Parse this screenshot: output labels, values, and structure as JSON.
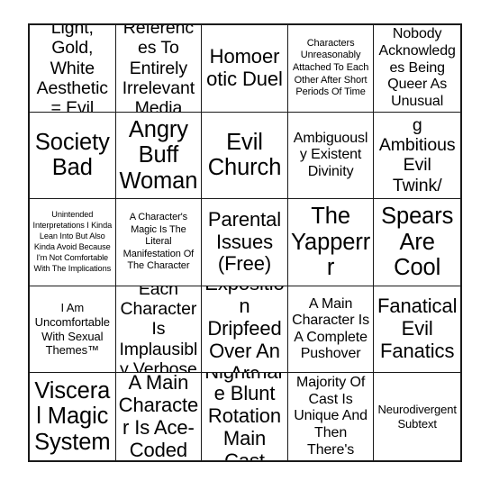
{
  "card": {
    "type": "bingo-card",
    "columns": 5,
    "rows": 5,
    "background_color": "#ffffff",
    "border_color": "#1a1a1a",
    "text_color": "#000000",
    "cells": [
      {
        "text": "Light, Gold, White Aesthetic = Evil",
        "size": "lg"
      },
      {
        "text": "References To Entirely Irrelevant Media",
        "size": "lg"
      },
      {
        "text": "Homoerotic Duel",
        "size": "xl"
      },
      {
        "text": "Characters Unreasonably Attached To Each Other After Short Periods Of Time",
        "size": "xs"
      },
      {
        "text": "Nobody Acknowledges Being Queer As Unusual",
        "size": "md"
      },
      {
        "text": "Society Bad",
        "size": "xxl"
      },
      {
        "text": "Angry Buff Woman",
        "size": "xxl"
      },
      {
        "text": "Evil Church",
        "size": "xxl"
      },
      {
        "text": "Ambiguously Existent Divinity",
        "size": "md"
      },
      {
        "text": "Controlling Ambitious Evil Twink/ Girlfailure",
        "size": "lg"
      },
      {
        "text": "Unintended Interpretations I Kinda Lean Into But Also Kinda Avoid Because I'm Not Comfortable With The Implications",
        "size": "xxs"
      },
      {
        "text": "A Character's Magic Is The Literal Manifestation Of The Character",
        "size": "xs"
      },
      {
        "text": "Parental Issues (Free)",
        "size": "xl"
      },
      {
        "text": "The Yapperrr",
        "size": "xxl"
      },
      {
        "text": "Spears Are Cool",
        "size": "xxl"
      },
      {
        "text": "I Am Uncomfortable With Sexual Themes™",
        "size": "sm"
      },
      {
        "text": "Each Character Is Implausibly Verbose",
        "size": "lg"
      },
      {
        "text": "Exposition Dripfeed Over An Arc",
        "size": "xl"
      },
      {
        "text": "A Main Character Is A Complete Pushover",
        "size": "md"
      },
      {
        "text": "Fanatical Evil Fanatics",
        "size": "xl"
      },
      {
        "text": "Visceral Magic System",
        "size": "xxl"
      },
      {
        "text": "A Main Character Is Ace-Coded",
        "size": "xl"
      },
      {
        "text": "Nightmare Blunt Rotation Main Cast",
        "size": "xl"
      },
      {
        "text": "Vast Majority Of Cast Is Unique And Then There's Norman",
        "size": "md"
      },
      {
        "text": "Neurodivergent Subtext",
        "size": "sm"
      }
    ]
  }
}
